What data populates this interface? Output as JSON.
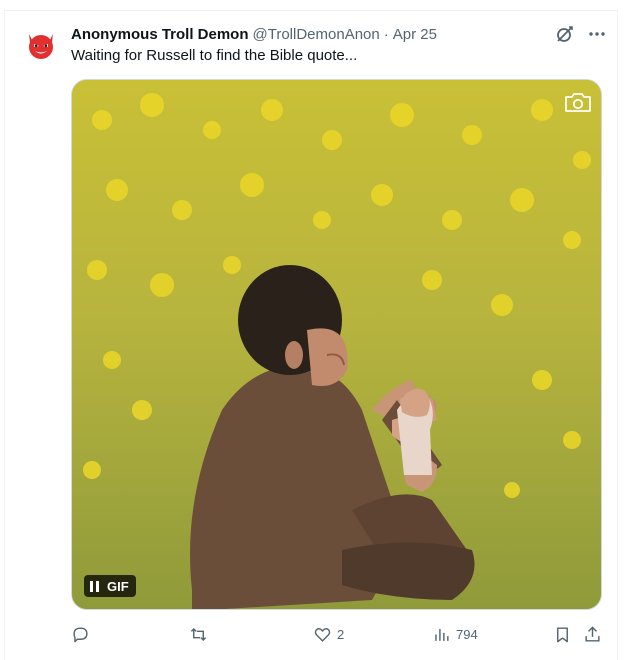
{
  "tweet": {
    "display_name": "Anonymous Troll Demon",
    "handle": "@TrollDemonAnon",
    "separator": "·",
    "date": "Apr 25",
    "text": "Waiting for Russell to find the Bible quote..."
  },
  "media": {
    "badge_label": "GIF",
    "colors": {
      "field": "#b9b23a",
      "flowers": "#e6d22a",
      "suit": "#6b4e3a",
      "hair": "#2a211b"
    }
  },
  "actions": {
    "reply_count": "",
    "retweet_count": "",
    "like_count": "2",
    "views_count": "794"
  },
  "icons": {
    "avatar": "devil-face-icon",
    "grok": "grok-icon",
    "more": "more-icon",
    "camera": "camera-icon",
    "pause": "pause-icon",
    "reply": "reply-icon",
    "retweet": "retweet-icon",
    "like": "heart-icon",
    "views": "views-icon",
    "bookmark": "bookmark-icon",
    "share": "share-icon"
  },
  "accent_colors": {
    "text": "#0f1419",
    "muted": "#536471",
    "border": "#cfd9de"
  }
}
